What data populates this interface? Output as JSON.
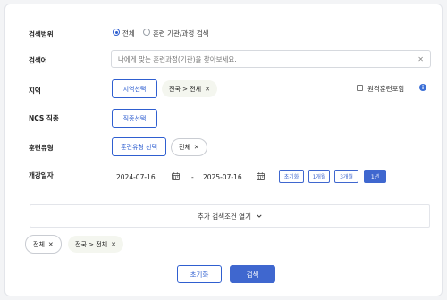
{
  "form": {
    "scope": {
      "label": "검색범위",
      "options": [
        {
          "label": "전체",
          "selected": true
        },
        {
          "label": "훈련 기관/과정 검색",
          "selected": false
        }
      ]
    },
    "keyword": {
      "label": "검색어",
      "placeholder": "나에게 맞는 훈련과정(기관)을 찾아보세요.",
      "clear_icon": "close-icon"
    },
    "region": {
      "label": "지역",
      "select_button": "지역선택",
      "chip": "전국 > 전체",
      "remote_label": "원격훈련포함",
      "info_icon": "info-icon",
      "info_glyph": "i"
    },
    "ncs": {
      "label": "NCS 직종",
      "select_button": "직종선택"
    },
    "training_type": {
      "label": "훈련유형",
      "select_button": "훈련유형 선택",
      "chip": "전체"
    },
    "start_date": {
      "label": "개강일자",
      "from": "2024-07-16",
      "separator": "-",
      "to": "2025-07-16",
      "period_buttons": [
        {
          "label": "초기화",
          "active": false
        },
        {
          "label": "1개월",
          "active": false
        },
        {
          "label": "3개월",
          "active": false
        },
        {
          "label": "1년",
          "active": true
        }
      ]
    }
  },
  "more_conditions": "추가 검색조건 열기",
  "selected_filters": [
    "전체",
    "전국 > 전체"
  ],
  "actions": {
    "reset": "초기화",
    "search": "검색"
  },
  "colors": {
    "accent": "#3f67cf",
    "border": "#d6d9de"
  }
}
